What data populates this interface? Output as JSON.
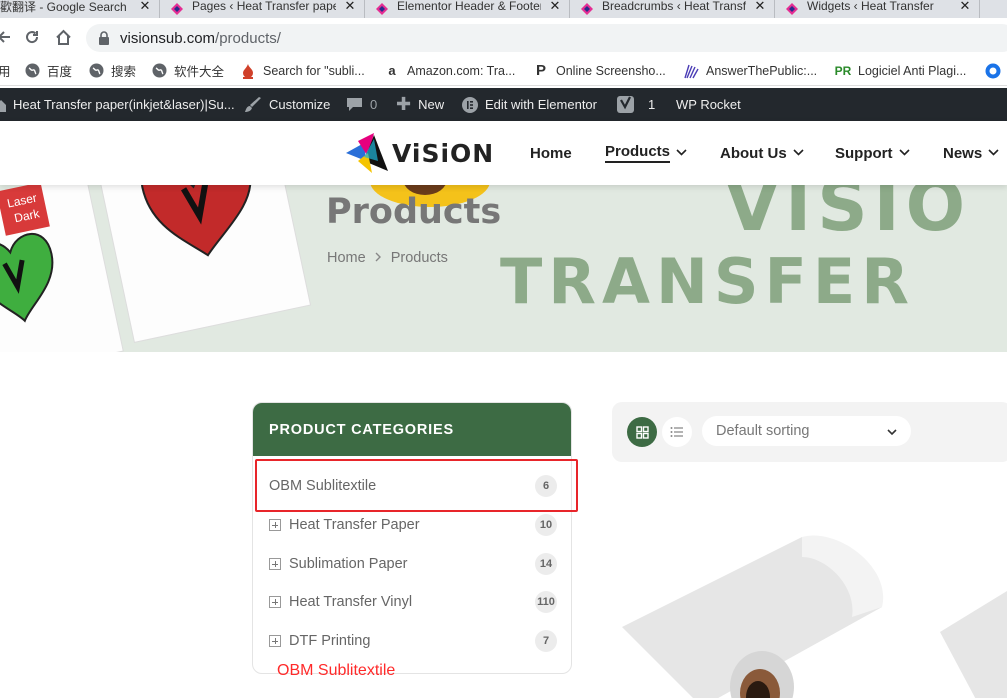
{
  "browser": {
    "tabs": [
      {
        "title": "歡翻译 - Google Search",
        "icon": "google-icon"
      },
      {
        "title": "Pages ‹ Heat Transfer paper",
        "icon": "elementor-icon"
      },
      {
        "title": "Elementor Header & Footer",
        "icon": "elementor-icon"
      },
      {
        "title": "Breadcrumbs ‹ Heat Transfer",
        "icon": "elementor-icon"
      },
      {
        "title": "Widgets ‹ Heat Transfer",
        "icon": "elementor-icon"
      }
    ],
    "tab_close": "✕",
    "url_host": "visionsub.com",
    "url_path": "/products/",
    "bookmarks": [
      {
        "label": "用",
        "icon": "apps-icon"
      },
      {
        "label": "百度",
        "icon": "globe-icon"
      },
      {
        "label": "搜索",
        "icon": "globe-icon"
      },
      {
        "label": "软件大全",
        "icon": "globe-icon"
      },
      {
        "label": "Search for \"subli...",
        "icon": "flame-icon"
      },
      {
        "label": "Amazon.com: Tra...",
        "icon": "amazon-icon"
      },
      {
        "label": "Online Screensho...",
        "icon": "p-icon"
      },
      {
        "label": "AnswerThePublic:...",
        "icon": "atp-icon"
      },
      {
        "label": "Logiciel Anti Plagi...",
        "icon": "pr-icon"
      }
    ]
  },
  "adminbar": {
    "site_name": "Heat Transfer paper(inkjet&laser)|Su...",
    "customize": "Customize",
    "comments": "0",
    "new": "New",
    "elementor": "Edit with Elementor",
    "yoast": "1",
    "rocket": "WP Rocket"
  },
  "header": {
    "logo_text": "ViSiON",
    "menu": [
      {
        "label": "Home",
        "dropdown": false,
        "active": false
      },
      {
        "label": "Products",
        "dropdown": true,
        "active": true
      },
      {
        "label": "About Us",
        "dropdown": true,
        "active": false
      },
      {
        "label": "Support",
        "dropdown": true,
        "active": false
      },
      {
        "label": "News",
        "dropdown": true,
        "active": false
      }
    ]
  },
  "hero": {
    "title": "Products",
    "breadcrumb_home": "Home",
    "breadcrumb_current": "Products",
    "sign_laser": "Laser",
    "sign_dark": "Dark",
    "bg_line1": "VISIO",
    "bg_line2": "TRANSFER"
  },
  "sidebar": {
    "heading": "PRODUCT CATEGORIES",
    "categories": [
      {
        "name": "OBM Sublitextile",
        "count": "6",
        "expandable": false
      },
      {
        "name": "Heat Transfer Paper",
        "count": "10",
        "expandable": true
      },
      {
        "name": "Sublimation Paper",
        "count": "14",
        "expandable": true
      },
      {
        "name": "Heat Transfer Vinyl",
        "count": "110",
        "expandable": true
      },
      {
        "name": "DTF Printing",
        "count": "7",
        "expandable": true
      }
    ]
  },
  "annotation": "OBM Sublitextile",
  "toolbar": {
    "sort_value": "Default sorting"
  },
  "colors": {
    "brand_green": "#3d6b44",
    "annotation_red": "#e8252a",
    "admin_bar": "#23282d"
  }
}
